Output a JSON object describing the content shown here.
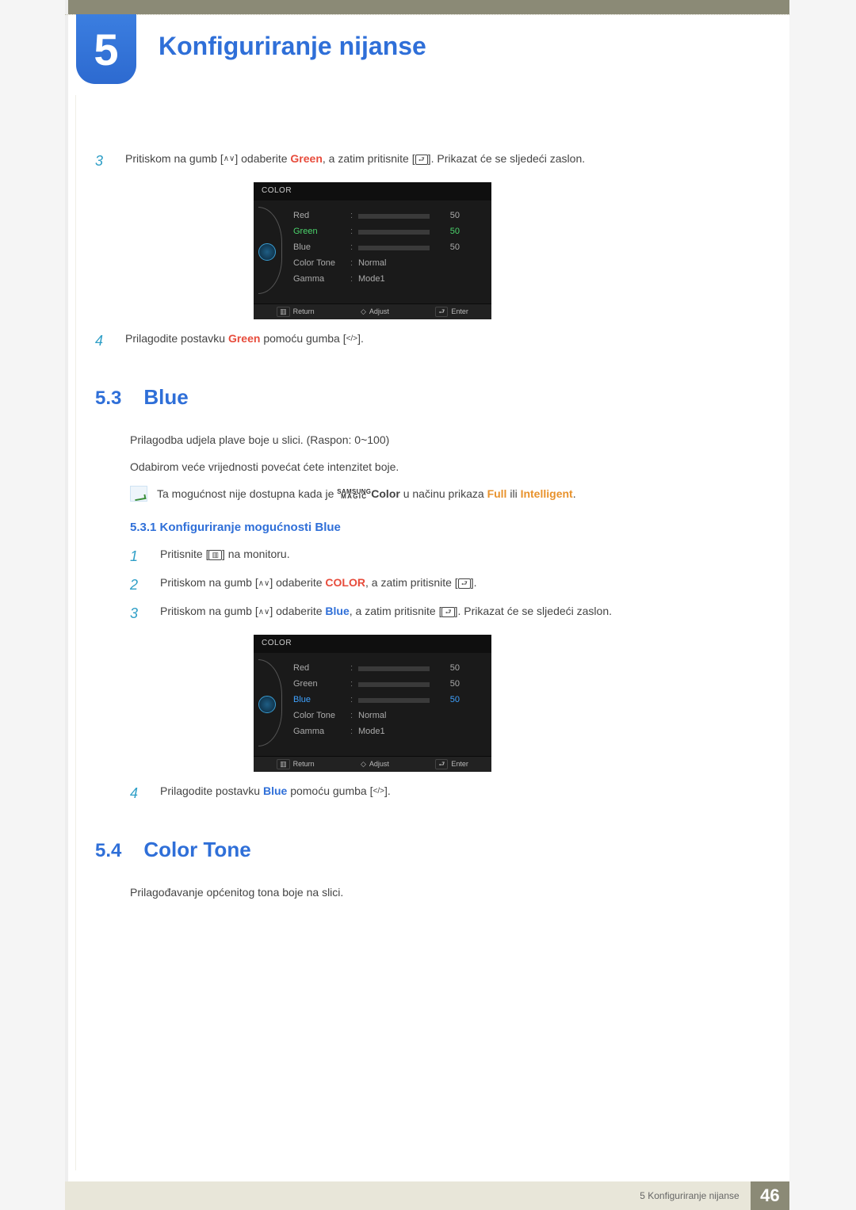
{
  "chapter": {
    "number": "5",
    "title": "Konfiguriranje nijanse"
  },
  "steps_top": {
    "s3": {
      "n": "3",
      "pre": "Pritiskom na gumb [",
      "mid1": "] odaberite ",
      "green": "Green",
      "mid2": ", a zatim pritisnite [",
      "post": "]. Prikazat će se sljedeći zaslon."
    },
    "s4": {
      "n": "4",
      "pre": "Prilagodite postavku ",
      "green": "Green",
      "mid": " pomoću gumba [",
      "post": "]."
    }
  },
  "osd1": {
    "header": "COLOR",
    "rows": {
      "red": {
        "label": "Red",
        "value": "50",
        "fill": 50
      },
      "green": {
        "label": "Green",
        "value": "50",
        "fill": 50
      },
      "blue": {
        "label": "Blue",
        "value": "50",
        "fill": 50
      },
      "tone": {
        "label": "Color Tone",
        "value": "Normal"
      },
      "gamma": {
        "label": "Gamma",
        "value": "Mode1"
      }
    },
    "footer": {
      "return": "Return",
      "adjust": "Adjust",
      "enter": "Enter"
    }
  },
  "section53": {
    "num": "5.3",
    "title": "Blue",
    "p1": "Prilagodba udjela plave boje u slici. (Raspon: 0~100)",
    "p2": "Odabirom veće vrijednosti povećat ćete intenzitet boje.",
    "note_pre": "Ta mogućnost nije dostupna kada je ",
    "note_color": "Color",
    "note_mid": " u načinu prikaza ",
    "note_full": "Full",
    "note_or": " ili ",
    "note_intel": "Intelligent",
    "note_end": ".",
    "magic_top": "SAMSUNG",
    "magic_bot": "MAGIC"
  },
  "subsection531": {
    "num_title": "5.3.1  Konfiguriranje mogućnosti Blue",
    "s1": {
      "n": "1",
      "pre": "Pritisnite [",
      "post": "] na monitoru."
    },
    "s2": {
      "n": "2",
      "pre": "Pritiskom na gumb [",
      "mid": "] odaberite ",
      "color": "COLOR",
      "mid2": ", a zatim pritisnite [",
      "post": "]."
    },
    "s3": {
      "n": "3",
      "pre": "Pritiskom na gumb [",
      "mid": "] odaberite ",
      "blue": "Blue",
      "mid2": ", a zatim pritisnite [",
      "post": "]. Prikazat će se sljedeći zaslon."
    },
    "s4": {
      "n": "4",
      "pre": "Prilagodite postavku ",
      "blue": "Blue",
      "mid": " pomoću gumba [",
      "post": "]."
    }
  },
  "osd2": {
    "header": "COLOR",
    "rows": {
      "red": {
        "label": "Red",
        "value": "50",
        "fill": 50
      },
      "green": {
        "label": "Green",
        "value": "50",
        "fill": 50
      },
      "blue": {
        "label": "Blue",
        "value": "50",
        "fill": 50
      },
      "tone": {
        "label": "Color Tone",
        "value": "Normal"
      },
      "gamma": {
        "label": "Gamma",
        "value": "Mode1"
      }
    },
    "footer": {
      "return": "Return",
      "adjust": "Adjust",
      "enter": "Enter"
    }
  },
  "section54": {
    "num": "5.4",
    "title": "Color Tone",
    "p1": "Prilagođavanje općenitog tona boje na slici."
  },
  "footer": {
    "text": "5 Konfiguriranje nijanse",
    "page": "46"
  }
}
